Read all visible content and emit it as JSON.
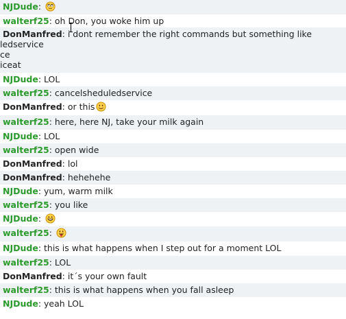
{
  "messages": [
    {
      "nick": "NJDude",
      "text": "",
      "emote": "rolling-eyes-emoticon"
    },
    {
      "nick": "walterf25",
      "text": "oh Don, you woke him up"
    },
    {
      "nick": "DonManfred",
      "text": "i dont remember the right commands but something like",
      "extra_lines": [
        "ledservice",
        "ce",
        "iceat"
      ]
    },
    {
      "nick": "NJDude",
      "text": "LOL"
    },
    {
      "nick": "walterf25",
      "text": "cancelsheduledservice"
    },
    {
      "nick": "DonManfred",
      "text": "or this",
      "emote": "smile-emoticon"
    },
    {
      "nick": "walterf25",
      "text": "here, here NJ, take your milk again"
    },
    {
      "nick": "NJDude",
      "text": "LOL"
    },
    {
      "nick": "walterf25",
      "text": "open wide"
    },
    {
      "nick": "DonManfred",
      "text": "lol"
    },
    {
      "nick": "DonManfred",
      "text": "hehehehe"
    },
    {
      "nick": "NJDude",
      "text": "yum, warm milk"
    },
    {
      "nick": "walterf25",
      "text": "you like"
    },
    {
      "nick": "NJDude",
      "text": "",
      "emote": "grin-emoticon"
    },
    {
      "nick": "walterf25",
      "text": "",
      "emote": "tongue-out-emoticon"
    },
    {
      "nick": "NJDude",
      "text": "this is what happens when I step out for a moment LOL"
    },
    {
      "nick": "walterf25",
      "text": "LOL"
    },
    {
      "nick": "DonManfred",
      "text": "it´s your own fault"
    },
    {
      "nick": "walterf25",
      "text": "this is what happens when you fall asleep"
    },
    {
      "nick": "NJDude",
      "text": "yeah LOL"
    }
  ],
  "colors": {
    "nick_green": "#2c9a2c",
    "nick_dark": "#242424",
    "row_alt": "#eef2f5",
    "row_norm": "#ffffff"
  }
}
